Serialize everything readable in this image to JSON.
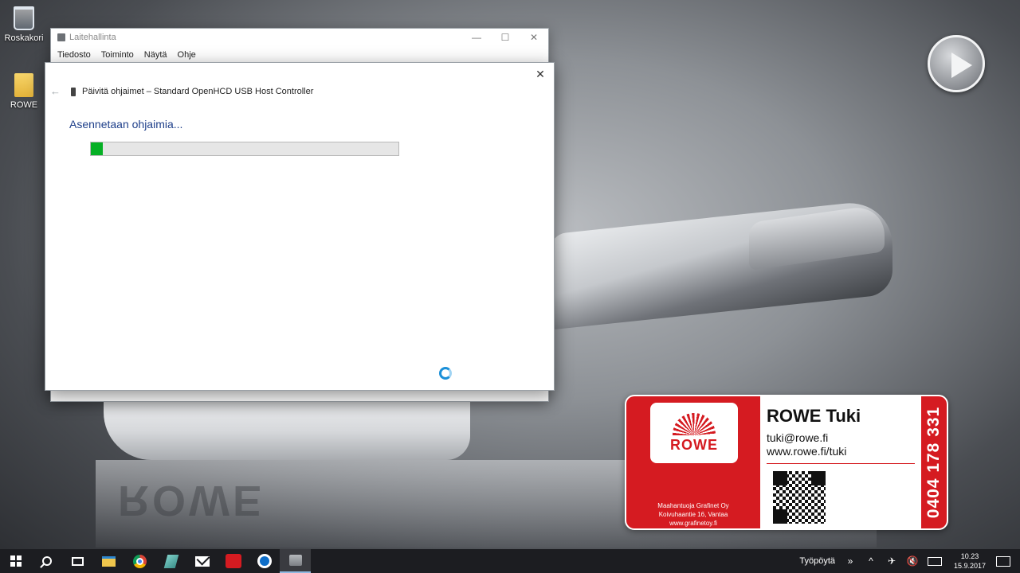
{
  "desktop": {
    "icons": [
      {
        "label": "Roskakori",
        "icon": "recycle-bin-icon"
      },
      {
        "label": "ROWE",
        "icon": "folder-icon"
      }
    ],
    "play_icon": "play-icon",
    "floor_logo": "ROWE"
  },
  "device_manager": {
    "title": "Laitehallinta",
    "menu": [
      "Tiedosto",
      "Toiminto",
      "Näytä",
      "Ohje"
    ],
    "controls": {
      "minimize": "—",
      "maximize": "☐",
      "close": "✕"
    }
  },
  "dialog": {
    "back_glyph": "←",
    "close_glyph": "✕",
    "heading": "Päivitä ohjaimet – Standard OpenHCD USB Host Controller",
    "status": "Asennetaan ohjaimia...",
    "progress_percent": 4,
    "progress_color": "#06b025"
  },
  "card": {
    "logo_text": "ROWE",
    "title": "ROWE Tuki",
    "email": "tuki@rowe.fi",
    "website": "www.rowe.fi/tuki",
    "importer_lines": [
      "Maahantuoja Grafinet Oy",
      "Koivuhaantie 16, Vantaa",
      "www.grafinetoy.fi"
    ],
    "phone": "0404 178 331",
    "brand_color": "#d51b21"
  },
  "taskbar": {
    "apps": [
      {
        "name": "start-button",
        "icon": "windows-icon"
      },
      {
        "name": "search-button",
        "icon": "search-icon"
      },
      {
        "name": "task-view-button",
        "icon": "task-view-icon"
      },
      {
        "name": "file-explorer-button",
        "icon": "folder-icon"
      },
      {
        "name": "chrome-button",
        "icon": "chrome-icon"
      },
      {
        "name": "paint-button",
        "icon": "paint-icon"
      },
      {
        "name": "mail-button",
        "icon": "mail-icon"
      },
      {
        "name": "rowe-app-button",
        "icon": "rowe-icon"
      },
      {
        "name": "teamviewer-button",
        "icon": "teamviewer-icon"
      },
      {
        "name": "device-manager-button",
        "icon": "device-manager-icon",
        "active": true
      }
    ],
    "tray": {
      "desktop_label": "Työpöytä",
      "chevron": "»",
      "expand": "^",
      "time": "10.23",
      "date": "15.9.2017"
    }
  }
}
